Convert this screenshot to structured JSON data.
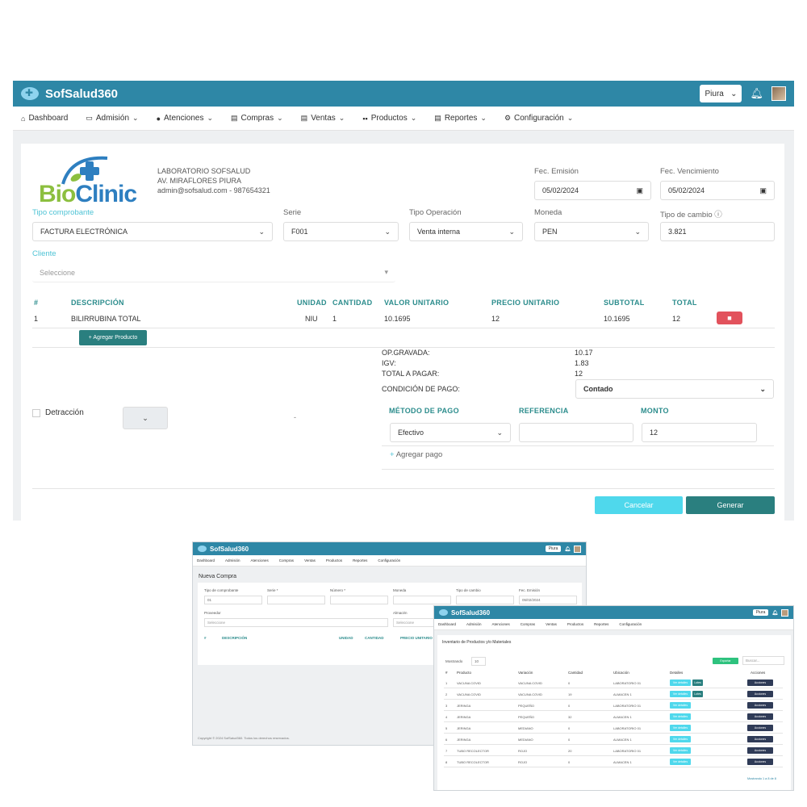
{
  "app": {
    "brand": "SofSalud360",
    "location": "Piura"
  },
  "nav": {
    "dashboard": "Dashboard",
    "admision": "Admisión",
    "atenciones": "Atenciones",
    "compras": "Compras",
    "ventas": "Ventas",
    "productos": "Productos",
    "reportes": "Reportes",
    "configuracion": "Configuración"
  },
  "company": {
    "logo_bio": "Bio",
    "logo_clinic": "Clinic",
    "name": "LABORATORIO SOFSALUD",
    "address": "AV. MIRAFLORES PIURA",
    "contact": "admin@sofsalud.com - 987654321"
  },
  "form": {
    "fec_emision_label": "Fec. Emisión",
    "fec_emision": "05/02/2024",
    "fec_venc_label": "Fec. Vencimiento",
    "fec_venc": "05/02/2024",
    "tipo_comp_label": "Tipo comprobante",
    "tipo_comp": "FACTURA ELECTRÓNICA",
    "serie_label": "Serie",
    "serie": "F001",
    "tipo_op_label": "Tipo Operación",
    "tipo_op": "Venta interna",
    "moneda_label": "Moneda",
    "moneda": "PEN",
    "tipo_cambio_label": "Tipo de cambio",
    "tipo_cambio": "3.821",
    "cliente_label": "Cliente",
    "cliente_placeholder": "Seleccione"
  },
  "items_table": {
    "headers": [
      "#",
      "DESCRIPCIÓN",
      "UNIDAD",
      "CANTIDAD",
      "VALOR UNITARIO",
      "PRECIO UNITARIO",
      "SUBTOTAL",
      "TOTAL"
    ],
    "rows": [
      [
        "1",
        "BILIRRUBINA TOTAL",
        "NIU",
        "1",
        "10.1695",
        "12",
        "10.1695",
        "12"
      ]
    ],
    "add_label": "+ Agregar Producto"
  },
  "summary": {
    "op_gravada_label": "OP.GRAVADA:",
    "op_gravada": "10.17",
    "igv_label": "IGV:",
    "igv": "1.83",
    "total_label": "TOTAL A PAGAR:",
    "total": "12",
    "condicion_label": "CONDICIÓN DE PAGO:",
    "condicion": "Contado"
  },
  "detraccion": {
    "label": "Detracción",
    "dash": "-"
  },
  "payment": {
    "metodo_label": "MÉTODO DE PAGO",
    "metodo": "Efectivo",
    "referencia_label": "REFERENCIA",
    "monto_label": "MONTO",
    "monto": "12",
    "add_label": "Agregar pago"
  },
  "actions": {
    "cancel": "Cancelar",
    "generate": "Generar"
  },
  "compra_window": {
    "brand": "SofSalud360",
    "location": "Piura",
    "nav": [
      "Dashboard",
      "Admisión",
      "Atenciones",
      "Compras",
      "Ventas",
      "Productos",
      "Reportes",
      "Configuración"
    ],
    "title": "Nueva Compra",
    "labels": [
      "Tipo de comprobante",
      "Serie *",
      "Número *",
      "Moneda",
      "Tipo de cambio",
      "Fec. Emisión"
    ],
    "tipo_value": "01",
    "fecha": "05/02/2024",
    "proveedor_label": "Proveedor",
    "proveedor_placeholder": "Seleccione",
    "almacen_label": "Almacén",
    "almacen_placeholder": "Seleccione",
    "headers": [
      "#",
      "DESCRIPCIÓN",
      "UNIDAD",
      "CANTIDAD",
      "PRECIO UNITARIO"
    ],
    "footer": "Copyright © 2024 SofSalud360. Todos los derechos reservados."
  },
  "inventario_window": {
    "brand": "SofSalud360",
    "location": "Piura",
    "nav": [
      "Dashboard",
      "Admisión",
      "Atenciones",
      "Compras",
      "Ventas",
      "Productos",
      "Reportes",
      "Configuración"
    ],
    "title": "Inventario de Productos y/o Materiales",
    "show_label": "Mostrando",
    "show_value": "10",
    "export_label": "Exportar",
    "search_placeholder": "Buscar...",
    "headers": [
      "#",
      "Producto",
      "Variación",
      "Cantidad",
      "Ubicación",
      "Detalles",
      "Acciones"
    ],
    "rows": [
      [
        "1",
        "VACUNA COVID",
        "VACUNA COVID",
        "0",
        "LABORATORIO 01"
      ],
      [
        "2",
        "VACUNA COVID",
        "VACUNA COVID",
        "19",
        "ALMACEN 1"
      ],
      [
        "3",
        "JERINGA",
        "PEQUEÑO",
        "0",
        "LABORATORIO 01"
      ],
      [
        "4",
        "JERINGA",
        "PEQUEÑO",
        "32",
        "ALMACEN 1"
      ],
      [
        "5",
        "JERINGA",
        "MEDIANO",
        "0",
        "LABORATORIO 01"
      ],
      [
        "6",
        "JERINGA",
        "MEDIANO",
        "0",
        "ALMACEN 1"
      ],
      [
        "7",
        "TUBO RECOLECTOR",
        "ROJO",
        "20",
        "LABORATORIO 01"
      ],
      [
        "8",
        "TUBO RECOLECTOR",
        "ROJO",
        "0",
        "ALMACEN 1"
      ]
    ],
    "detail_btn": "Ver detalles",
    "lote_btn": "Lotes",
    "action_btn": "Acciones",
    "pagination": "Mostrando 1 a 8 de 8"
  }
}
